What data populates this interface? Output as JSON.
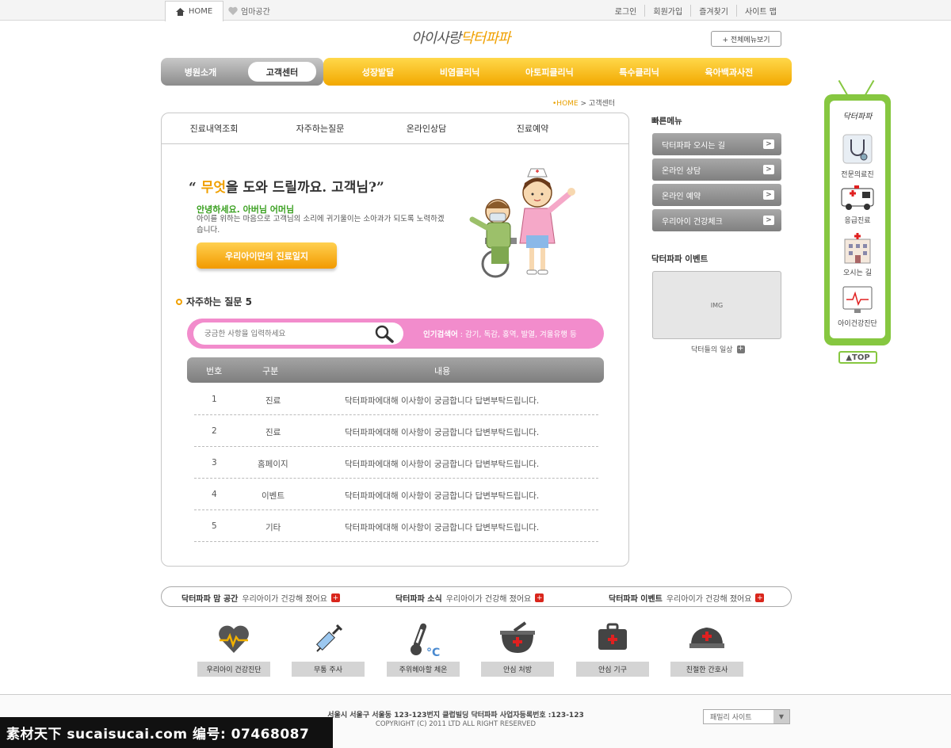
{
  "topbar": {
    "home_tab": "HOME",
    "mom_space": "엄마공간",
    "links": [
      "로그인",
      "회원가입",
      "즐겨찾기",
      "사이트 맵"
    ]
  },
  "logo": {
    "part1": "아이사랑",
    "part2": "닥터파파"
  },
  "all_menu": "+ 전체메뉴보기",
  "gnb": {
    "hospital": "병원소개",
    "customer": "고객센터",
    "items": [
      "성장발달",
      "비염클리닉",
      "아토피클리닉",
      "특수클리닉",
      "육아백과사전"
    ]
  },
  "breadcrumb": {
    "home": "•HOME",
    "sep": ">",
    "current": "고객센터"
  },
  "subtabs": [
    "진료내역조회",
    "자주하는질문",
    "온라인상담",
    "진료예약"
  ],
  "headline": {
    "open": "“ ",
    "highlight": "무엇",
    "rest": "을 도와 드릴까요. 고객님?”"
  },
  "greeting": {
    "title": "안녕하세요. 아버님 어머님",
    "desc": "아이를 위하는 마음으로 고객님의 소리에 귀기울이는 소아과가 되도록 노력하겠습니다."
  },
  "diary_button": "우리아이만의 진료일지",
  "faq": {
    "title": "자주하는 질문 5"
  },
  "search": {
    "placeholder": "궁금한 사항을 입력하세요",
    "popular_label": "인기검색어",
    "popular_terms": " : 감기, 독감, 홍역, 발열, 겨울유행 등"
  },
  "table": {
    "headers": [
      "번호",
      "구분",
      "내용"
    ],
    "rows": [
      {
        "no": "1",
        "category": "진료",
        "content": "닥터파파에대해 이사항이 궁금합니다 답변부탁드립니다."
      },
      {
        "no": "2",
        "category": "진료",
        "content": "닥터파파에대해 이사항이 궁금합니다 답변부탁드립니다."
      },
      {
        "no": "3",
        "category": "홈페이지",
        "content": "닥터파파에대해 이사항이 궁금합니다 답변부탁드립니다."
      },
      {
        "no": "4",
        "category": "이벤트",
        "content": "닥터파파에대해 이사항이 궁금합니다 답변부탁드립니다."
      },
      {
        "no": "5",
        "category": "기타",
        "content": "닥터파파에대해 이사항이 궁금합니다 답변부탁드립니다."
      }
    ]
  },
  "quick_menu": {
    "title": "빠른메뉴",
    "items": [
      "닥터파파 오시는 길",
      "온라인 상담",
      "온라인 예약",
      "우리아이 건강체크"
    ]
  },
  "event": {
    "title": "닥터파파 이벤트",
    "img_placeholder": "IMG",
    "daily": "닥터들의 일상"
  },
  "side_tv": {
    "logo": "닥터파파",
    "items": [
      "전문의료진",
      "응급진료",
      "오시는 길",
      "아이건강진단"
    ],
    "top": "▲TOP"
  },
  "bottom_band": [
    {
      "title": "닥터파파 맘 공간",
      "desc": "우리아이가 건강해 졌어요"
    },
    {
      "title": "닥터파파 소식",
      "desc": "우리아이가 건강해 졌어요"
    },
    {
      "title": "닥터파파 이벤트",
      "desc": "우리아이가 건강해 졌어요"
    }
  ],
  "bottom_icons": [
    "우리아이 건강진단",
    "무통 주사",
    "주위헤아할 체온",
    "안심 처방",
    "안심 기구",
    "친절한 간호사"
  ],
  "footer": {
    "address": "서울시 서울구 서울동 123-123번지 클럽빌딩 닥터파파 사업자등록번호 :123-123",
    "copyright": "COPYRIGHT (C) 2011 LTD ALL RIGHT RESERVED",
    "family_site": "패밀리 사이트"
  },
  "watermark": "素材天下 sucaisucai.com  编号: 07468087",
  "colors": {
    "accent_yellow": "#f2a800",
    "accent_green": "#86c740",
    "search_pink": "#f28ccc",
    "gray_button": "#8c8c8c"
  }
}
